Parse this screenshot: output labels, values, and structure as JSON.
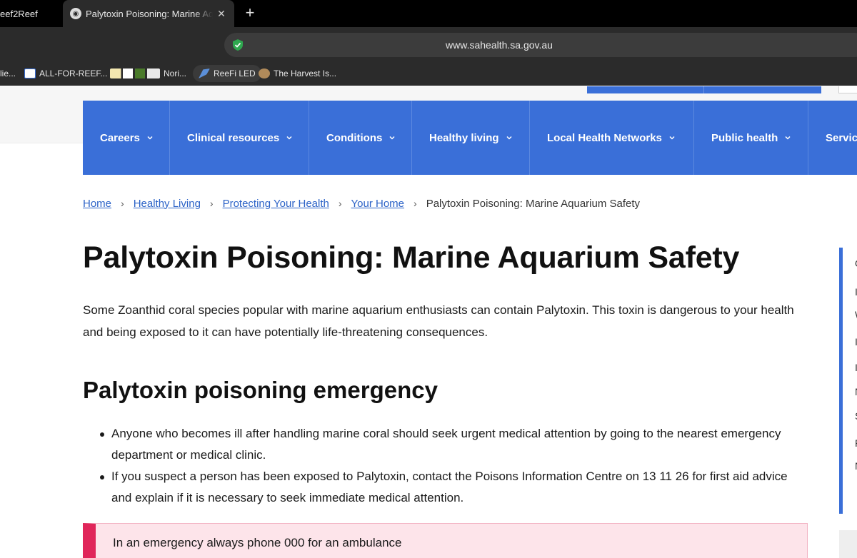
{
  "browser": {
    "tabs": [
      {
        "title": "eef2Reef",
        "active": false
      },
      {
        "title": "Palytoxin Poisoning: Marine Aquarium Safety",
        "active": true
      }
    ],
    "url": "www.sahealth.sa.gov.au",
    "bookmarks": [
      {
        "label": "lie...",
        "icon": "bookmark-icon"
      },
      {
        "label": "ALL-FOR-REEF...",
        "icon": "brightwell-icon"
      },
      {
        "label": "Nori...",
        "icon": "supplement-icons"
      },
      {
        "label": "ReeFi LED",
        "icon": "reefi-icon"
      },
      {
        "label": "The Harvest Is...",
        "icon": "harvest-icon"
      }
    ]
  },
  "nav": {
    "items": [
      {
        "label": "Careers"
      },
      {
        "label": "Clinical resources"
      },
      {
        "label": "Conditions"
      },
      {
        "label": "Healthy living"
      },
      {
        "label": "Local Health Networks"
      },
      {
        "label": "Public health"
      },
      {
        "label": "Servic"
      }
    ]
  },
  "breadcrumb": {
    "links": [
      "Home",
      "Healthy Living",
      "Protecting Your Health",
      "Your Home"
    ],
    "current": "Palytoxin Poisoning: Marine Aquarium Safety"
  },
  "content": {
    "title": "Palytoxin Poisoning: Marine Aquarium Safety",
    "intro": "Some Zoanthid coral species popular with marine aquarium enthusiasts can contain Palytoxin. This toxin is dangerous to your health and being exposed to it can have potentially life-threatening consequences.",
    "emergency_heading": "Palytoxin poisoning emergency",
    "bullets": [
      "Anyone who becomes ill after handling marine coral should seek urgent medical attention by going to the nearest emergency department or medical clinic.",
      "If you suspect a person has been exposed to Palytoxin, contact the Poisons Information Centre on 13 11 26 for first aid advice and explain if it is necessary to seek immediate medical attention."
    ],
    "alert": "In an emergency always phone 000 for an ambulance"
  },
  "sidebar_fragments": [
    "O",
    "I",
    "W",
    "I",
    "I",
    "N",
    "S",
    "P",
    "N"
  ],
  "colors": {
    "nav_blue": "#3a6fd8",
    "link_blue": "#2b62c7",
    "alert_accent": "#e0265a",
    "alert_bg": "#fde4ea"
  }
}
